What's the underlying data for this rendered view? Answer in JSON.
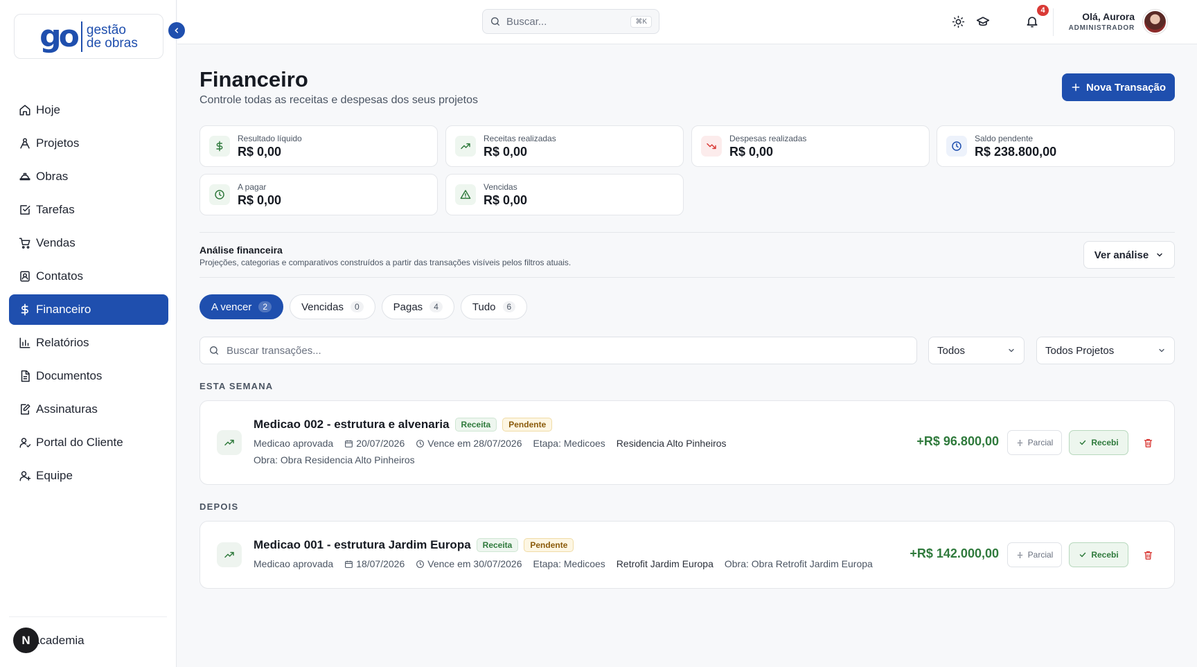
{
  "colors": {
    "primary": "#1f4fae",
    "income": "#2f7a3c",
    "expense": "#d93a36",
    "warning": "#8a5a0a"
  },
  "brand": {
    "logo_go": "go",
    "logo_line1": "gestão",
    "logo_line2": "de obras"
  },
  "sidebar": {
    "items": [
      {
        "label": "Hoje",
        "icon": "home-icon"
      },
      {
        "label": "Projetos",
        "icon": "projects-icon"
      },
      {
        "label": "Obras",
        "icon": "helmet-icon"
      },
      {
        "label": "Tarefas",
        "icon": "task-check-icon"
      },
      {
        "label": "Vendas",
        "icon": "cart-icon"
      },
      {
        "label": "Contatos",
        "icon": "contacts-icon"
      },
      {
        "label": "Financeiro",
        "icon": "dollar-icon",
        "active": true
      },
      {
        "label": "Relatórios",
        "icon": "bar-chart-icon"
      },
      {
        "label": "Documentos",
        "icon": "document-icon"
      },
      {
        "label": "Assinaturas",
        "icon": "signature-icon"
      },
      {
        "label": "Portal do Cliente",
        "icon": "client-portal-icon"
      },
      {
        "label": "Equipe",
        "icon": "team-icon"
      }
    ],
    "academia": {
      "badge": "N",
      "label": "Academia"
    }
  },
  "topbar": {
    "search_placeholder": "Buscar...",
    "shortcut": "⌘K",
    "notifications_count": "4",
    "greeting": "Olá, Aurora",
    "role": "ADMINISTRADOR"
  },
  "page": {
    "title": "Financeiro",
    "subtitle": "Controle todas as receitas e despesas dos seus projetos",
    "new_button": "Nova Transação"
  },
  "stats": [
    {
      "label": "Resultado líquido",
      "value": "R$ 0,00",
      "icon": "dollar-icon"
    },
    {
      "label": "Receitas realizadas",
      "value": "R$ 0,00",
      "icon": "trending-up-icon"
    },
    {
      "label": "Despesas realizadas",
      "value": "R$ 0,00",
      "icon": "trending-down-icon"
    },
    {
      "label": "Saldo pendente",
      "value": "R$ 238.800,00",
      "icon": "clock-icon"
    },
    {
      "label": "A pagar",
      "value": "R$ 0,00",
      "icon": "clock-icon"
    },
    {
      "label": "Vencidas",
      "value": "R$ 0,00",
      "icon": "warning-icon"
    }
  ],
  "analysis": {
    "title": "Análise financeira",
    "subtitle": "Projeções, categorias e comparativos construídos a partir das transações visíveis pelos filtros atuais.",
    "button": "Ver análise"
  },
  "tabs": [
    {
      "label": "A vencer",
      "count": "2",
      "active": true
    },
    {
      "label": "Vencidas",
      "count": "0"
    },
    {
      "label": "Pagas",
      "count": "4"
    },
    {
      "label": "Tudo",
      "count": "6"
    }
  ],
  "filters": {
    "search_placeholder": "Buscar transações...",
    "type_selected": "Todos",
    "project_selected": "Todos Projetos"
  },
  "groups": [
    {
      "label": "ESTA SEMANA",
      "transactions": [
        {
          "title": "Medicao 002 - estrutura e alvenaria",
          "type_badge": "Receita",
          "status_badge": "Pendente",
          "description": "Medicao aprovada",
          "date": "20/07/2026",
          "due": "Vence em 28/07/2026",
          "stage": "Etapa: Medicoes",
          "project": "Residencia Alto Pinheiros",
          "obra": "Obra: Obra Residencia Alto Pinheiros",
          "amount": "+R$ 96.800,00",
          "partial_label": "Parcial",
          "received_label": "Recebi"
        }
      ]
    },
    {
      "label": "DEPOIS",
      "transactions": [
        {
          "title": "Medicao 001 - estrutura Jardim Europa",
          "type_badge": "Receita",
          "status_badge": "Pendente",
          "description": "Medicao aprovada",
          "date": "18/07/2026",
          "due": "Vence em 30/07/2026",
          "stage": "Etapa: Medicoes",
          "project": "Retrofit Jardim Europa",
          "obra": "Obra: Obra Retrofit Jardim Europa",
          "amount": "+R$ 142.000,00",
          "partial_label": "Parcial",
          "received_label": "Recebi"
        }
      ]
    }
  ]
}
